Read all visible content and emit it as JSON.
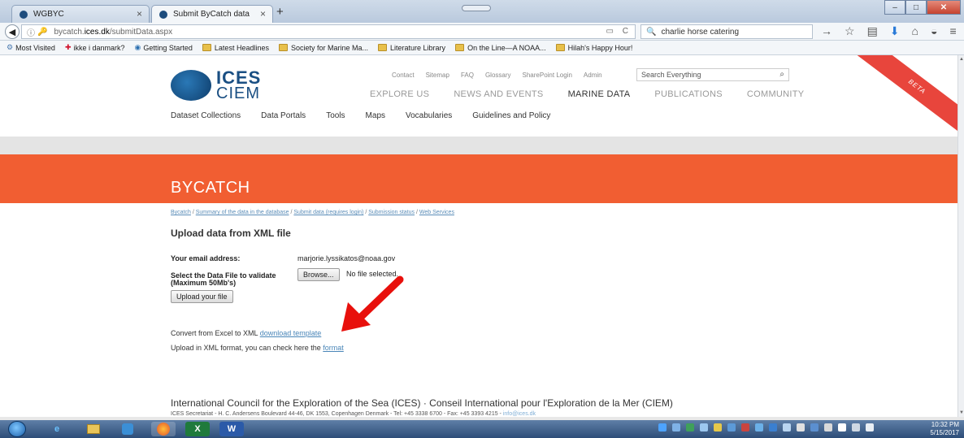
{
  "browser": {
    "tabs": [
      {
        "label": "WGBYC"
      },
      {
        "label": "Submit ByCatch data"
      }
    ],
    "url": {
      "prefix": "bycatch.",
      "domain": "ices.dk",
      "path": "/submitData.aspx"
    },
    "search_value": "charlie horse catering",
    "bookmarks": [
      "Most Visited",
      "ikke i danmark?",
      "Getting Started",
      "Latest Headlines",
      "Society for Marine Ma...",
      "Literature Library",
      "On the Line—A NOAA...",
      "Hilah's Happy Hour!"
    ]
  },
  "site": {
    "logo_top": "ICES",
    "logo_bottom": "CIEM",
    "util_links": [
      "Contact",
      "Sitemap",
      "FAQ",
      "Glossary",
      "SharePoint Login",
      "Admin"
    ],
    "search_placeholder": "Search Everything",
    "main_nav": [
      "EXPLORE US",
      "NEWS AND EVENTS",
      "MARINE DATA",
      "PUBLICATIONS",
      "COMMUNITY"
    ],
    "sub_nav": [
      "Dataset Collections",
      "Data Portals",
      "Tools",
      "Maps",
      "Vocabularies",
      "Guidelines and Policy"
    ],
    "beta": "BETA"
  },
  "banner": {
    "title": "BYCATCH"
  },
  "breadcrumbs": [
    "Bycatch",
    "Summary of the data in the database",
    "Submit data (requires login)",
    "Submission status",
    "Web Services"
  ],
  "form": {
    "title": "Upload data from XML file",
    "email_label": "Your email address:",
    "email_value": "marjorie.lyssikatos@noaa.gov",
    "file_label_1": "Select the Data File to validate",
    "file_label_2": "(Maximum 50Mb's)",
    "browse_label": "Browse...",
    "file_status": "No file selected.",
    "upload_label": "Upload your file",
    "convert_text": "Convert from Excel to XML",
    "convert_link": "download template",
    "format_text": "Upload in XML format, you can check here the",
    "format_link": "format"
  },
  "footer": {
    "title": "International Council for the Exploration of the Sea (ICES) · Conseil International pour l'Exploration de la Mer (CIEM)",
    "address": "ICES Secretariat - H. C. Andersens Boulevard 44-46, DK 1553, Copenhagen Denmark - Tel: +45 3338 6700 - Fax: +45 3393 4215 -",
    "email": "info@ices.dk"
  },
  "taskbar": {
    "time": "10:32 PM",
    "date": "5/15/2017"
  },
  "colors": {
    "banner": "#f15e32",
    "link": "#4a86b8",
    "arrow": "#e8100c",
    "beta": "#e8453c"
  }
}
